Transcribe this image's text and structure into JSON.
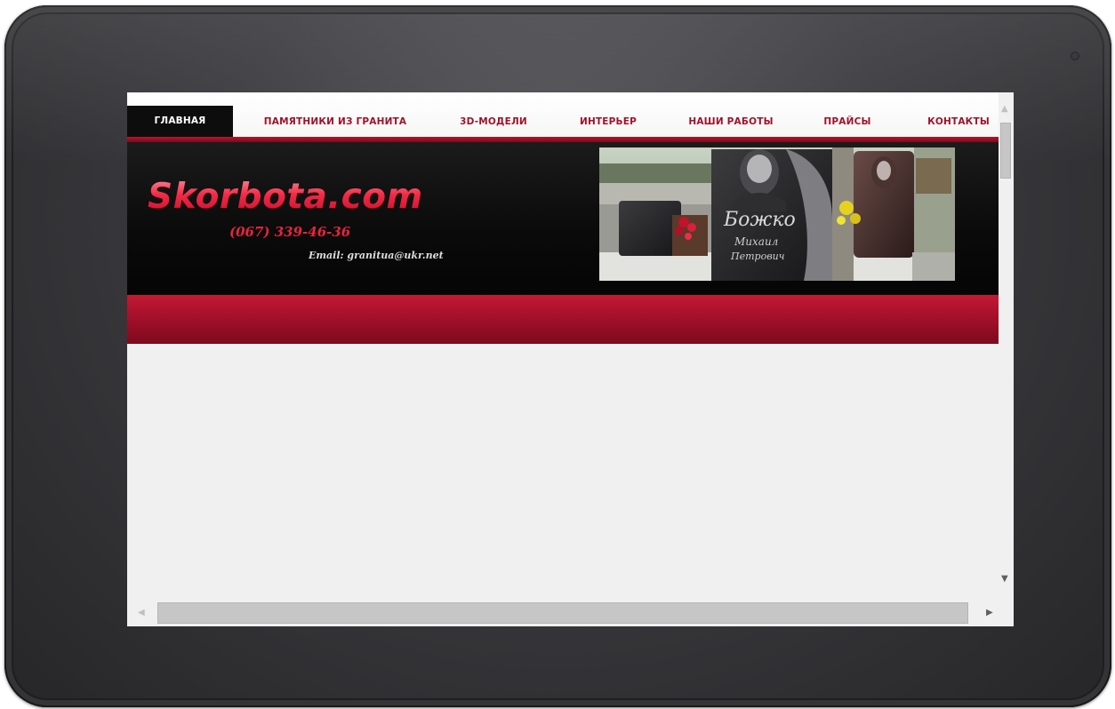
{
  "nav": {
    "items": [
      {
        "label": "ГЛАВНАЯ",
        "active": true
      },
      {
        "label": "ПАМЯТНИКИ ИЗ ГРАНИТА"
      },
      {
        "label": "3D-МОДЕЛИ"
      },
      {
        "label": "ИНТЕРЬЕР"
      },
      {
        "label": "НАШИ РАБОТЫ"
      },
      {
        "label": "ПРАЙСЫ"
      },
      {
        "label": "КОНТАКТЫ"
      }
    ]
  },
  "header": {
    "logo": "Skorbota.com",
    "phone": "(067) 339-46-36",
    "email": "Email: granitua@ukr.net"
  },
  "photo": {
    "engraving_surname": "Божко",
    "engraving_name": "Михаил",
    "engraving_patronymic": "Петрович"
  },
  "colors": {
    "accent": "#a0122a",
    "band": "#b0162e",
    "bezel": "#333336"
  },
  "icons": {
    "scroll_up": "triangle-up",
    "scroll_down": "triangle-down",
    "scroll_left": "triangle-left",
    "scroll_right": "triangle-right"
  }
}
